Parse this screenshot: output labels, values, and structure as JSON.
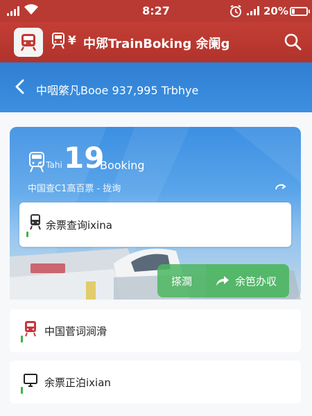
{
  "status_bar": {
    "time": "8:27",
    "battery_text": "20%",
    "battery_level": 0.2,
    "icons": [
      "signal-icon",
      "wifi-icon",
      "alarm-icon",
      "cell-bars-icon",
      "battery-icon"
    ]
  },
  "app_bar": {
    "title": "中郳TrainBoking 余阑g",
    "currency_glyph": "¥",
    "icons": [
      "app-logo-icon",
      "train-icon",
      "yen-icon",
      "search-icon"
    ]
  },
  "sub_header": {
    "title": "中咽綮凡Booe 937,995 Trbhye",
    "icons": [
      "back-icon"
    ]
  },
  "banner": {
    "prefix": "C Tahi",
    "number": "19",
    "booking": "Booking",
    "subtitle": "中国查C1高百票 - 拢询",
    "input_text": "余票查询ixina",
    "search_button": "搽澗",
    "action_button": "余笆办収",
    "icons": [
      "train-logo-icon",
      "refresh-icon",
      "subway-icon",
      "share-arrow-icon"
    ]
  },
  "list": [
    {
      "label": "中国菅词涧滑",
      "icon": "train-red-icon"
    },
    {
      "label": "余票正泊ixian",
      "icon": "monitor-icon"
    }
  ],
  "colors": {
    "primary_red": "#b93a33",
    "header_blue": "#2f7fd3",
    "accent_green": "#3cb54a"
  }
}
